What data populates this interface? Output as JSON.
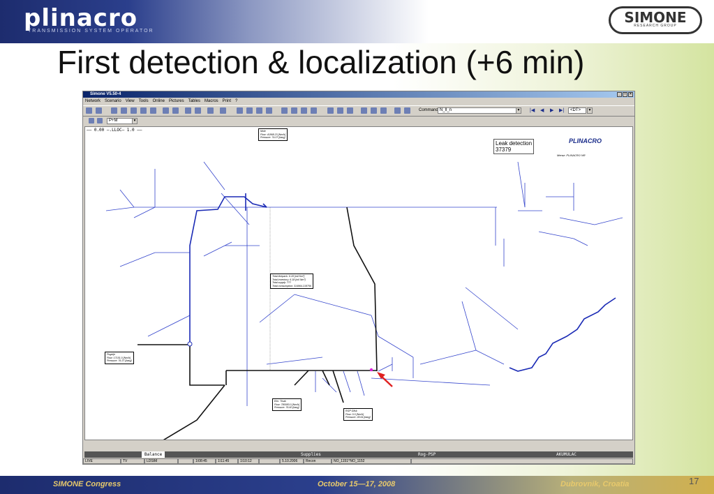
{
  "slide": {
    "title": "First detection & localization (+6 min)",
    "page_number": "17",
    "logo_left": "plinacro",
    "logo_left_sub": "TRANSMISSION SYSTEM OPERATOR",
    "logo_right": "SIMONE",
    "logo_right_sub": "RESEARCH GROUP",
    "footer_left": "SIMONE Congress",
    "footer_center": "October 15—17, 2008",
    "footer_right": "Dubrovnik, Croatia"
  },
  "app": {
    "window_title": "Simone V5.50-4",
    "menu": [
      "Network",
      "Scenario",
      "View",
      "Tools",
      "Online",
      "Pictures",
      "Tables",
      "Macros",
      "Print",
      "?"
    ],
    "command_label": "Command:",
    "command_value": "N_ll_n",
    "dt_value": "<DT>",
    "view_select": "P+M",
    "legend_text": "—— 0.00 —.LLOC— 1.0 ——",
    "leak_detection_label": "Leak detection",
    "leak_detection_value": "37379",
    "mini_logo": "PLINACRO",
    "meraz_text": "Meraz: PLINACRO NR",
    "popups": {
      "top": [
        "Mole",
        "Flow: 41868.23 [Nm/h]",
        "Pressure: 74.07 [barg]"
      ],
      "center": [
        "Total linepack: 6.18 [mil Nm³]",
        "Total inventory: 6.18 [mil Nm³]",
        "Total supply: ???",
        "Total consumption: 314964.218756"
      ],
      "left": [
        "Pogelje",
        "Flow: 17151.0 [Nm/h]",
        "Pressure: 76.37 [barg]"
      ],
      "bottom1": [
        "Elm. Tisak",
        "Flow: 780083.0 [Nm/h]",
        "Pressure: 76.60 [barg]"
      ],
      "bottom2": [
        "RGP Glisk",
        "Flow: 0.0 [Nm/h]",
        "Pressure: 28.64 [barg]"
      ]
    },
    "tabs": [
      "Balance",
      "Supplies",
      "Rog-PSP",
      "AKUMULAC"
    ],
    "status": [
      "LIVE",
      "TV",
      "LDSIM",
      "",
      "1\\08:45",
      "1\\11:45",
      "1\\10:12",
      "",
      "5.10.2006",
      "Recon",
      "NO_1151^NO_1152"
    ]
  },
  "colors": {
    "pipe_blue": "#3344cc",
    "pipe_dark": "#111111",
    "leak_marker": "#dd22dd",
    "arrow": "#e02020"
  }
}
